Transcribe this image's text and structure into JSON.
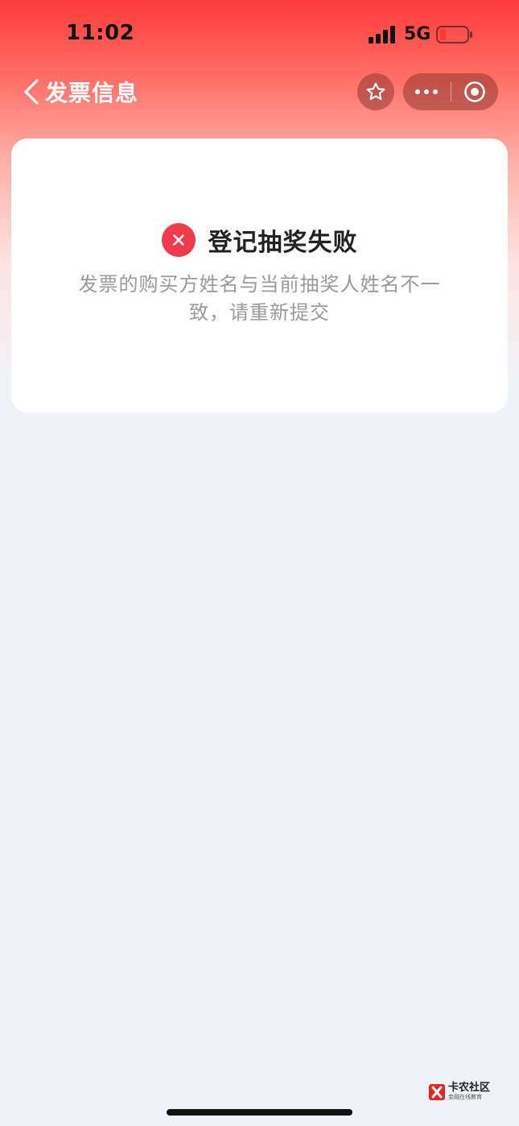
{
  "status_bar": {
    "time": "11:02",
    "network": "5G"
  },
  "nav": {
    "title": "发票信息"
  },
  "result": {
    "title": "登记抽奖失败",
    "description": "发票的购买方姓名与当前抽奖人姓名不一致，请重新提交"
  },
  "watermark": {
    "name": "卡农社区",
    "slogan": "金融在线教育"
  },
  "colors": {
    "header_red": "#ff3b3b",
    "error_red": "#ef3b4c",
    "page_bg": "#f0f2f7",
    "desc_gray": "#9a9a9a",
    "battery_low": "#ff3b30"
  },
  "icons": {
    "back": "chevron-left-icon",
    "favorite": "star-icon",
    "more": "more-dots-icon",
    "close": "target-circle-icon",
    "error": "close-icon",
    "signal": "signal-bars-icon",
    "battery": "battery-icon"
  }
}
